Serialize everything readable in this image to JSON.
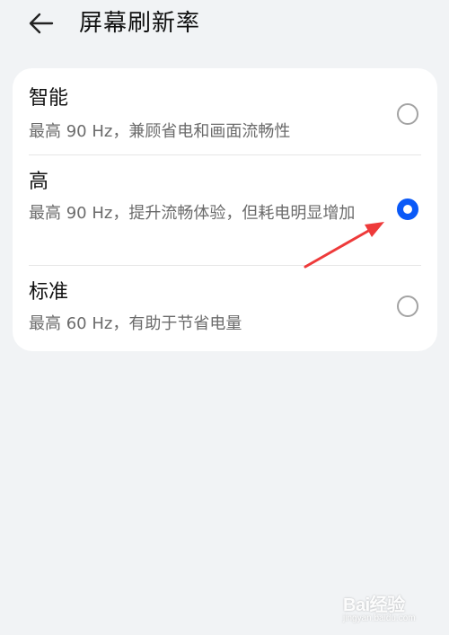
{
  "header": {
    "title": "屏幕刷新率",
    "back_icon": "back-arrow-icon"
  },
  "options": [
    {
      "title": "智能",
      "desc": "最高 90 Hz，兼顾省电和画面流畅性",
      "selected": false
    },
    {
      "title": "高",
      "desc": "最高 90 Hz，提升流畅体验，但耗电明显增加",
      "selected": true
    },
    {
      "title": "标准",
      "desc": "最高 60 Hz，有助于节省电量",
      "selected": false
    }
  ],
  "annotation": {
    "icon": "red-arrow-icon",
    "color": "#ee3a3a"
  },
  "colors": {
    "accent": "#0a59f7",
    "background": "#f1f3f5",
    "card": "#ffffff"
  },
  "watermark": {
    "brand": "Bai经验",
    "sub": "jingyan.baidu.com"
  }
}
